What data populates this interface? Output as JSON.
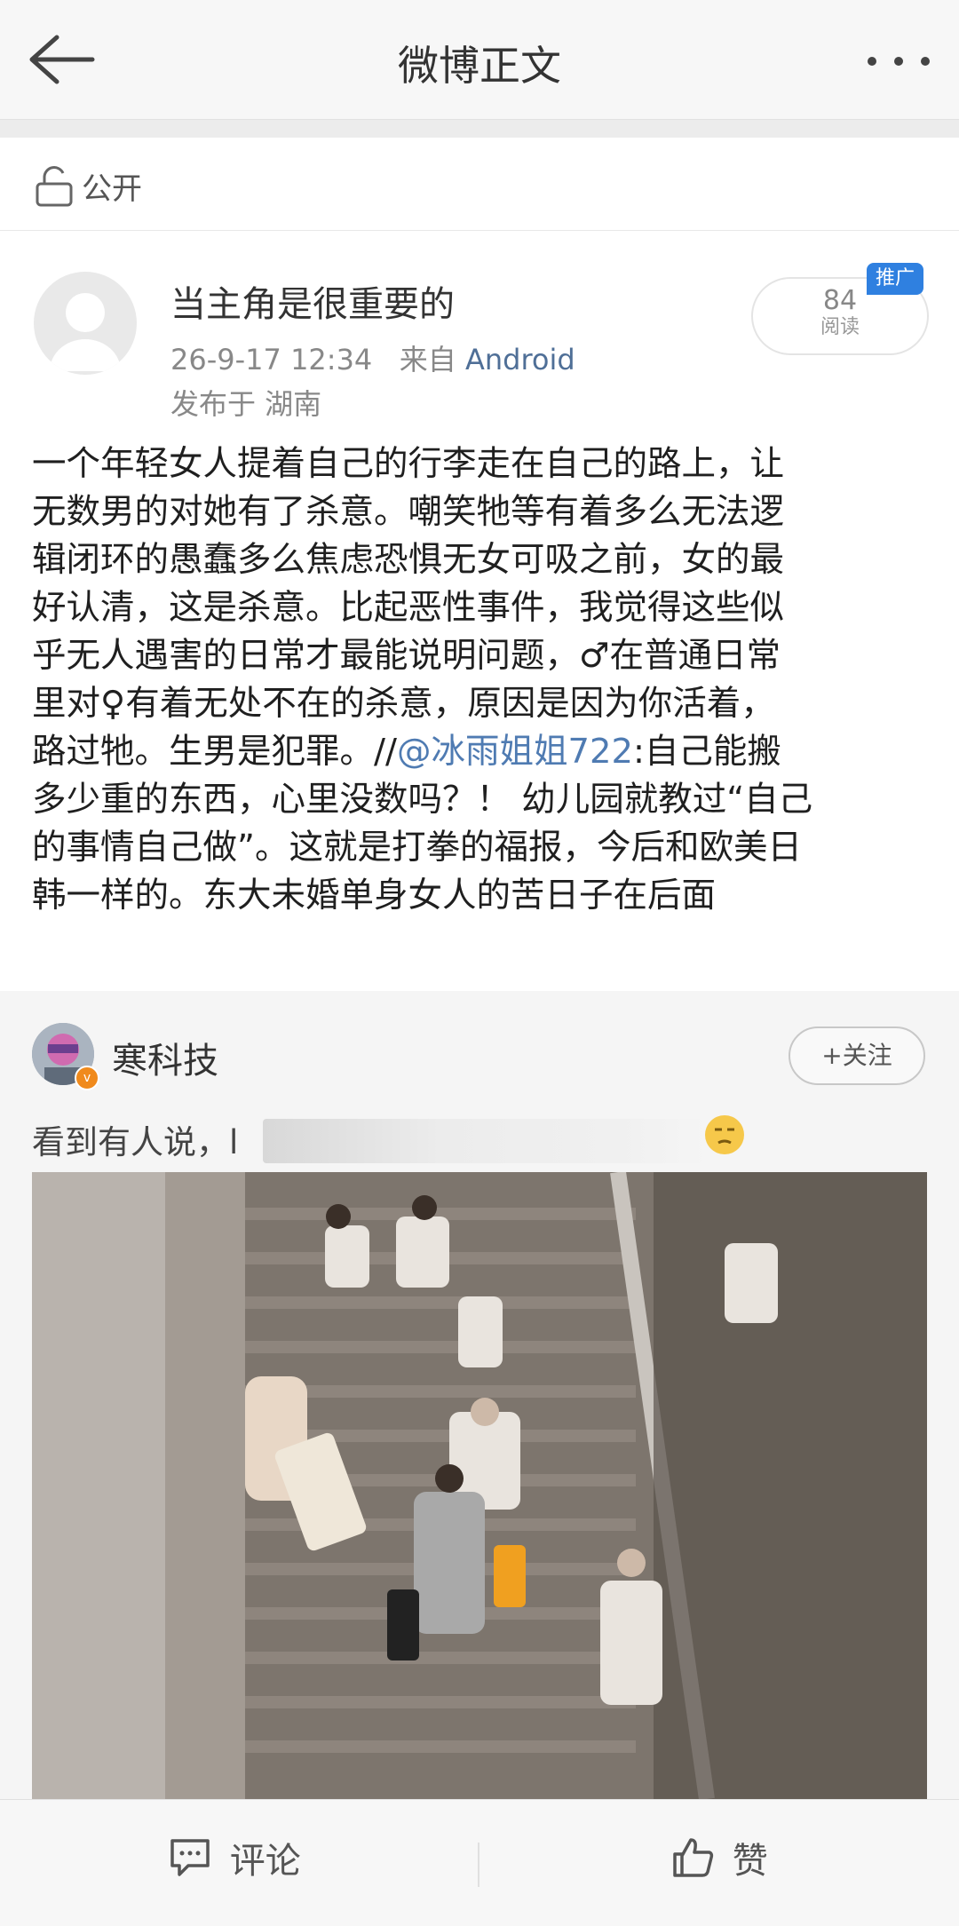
{
  "header": {
    "title": "微博正文",
    "back_icon": "back-arrow-icon",
    "more_icon": "more-dots-icon"
  },
  "visibility": {
    "label": "公开",
    "icon": "unlock-icon"
  },
  "post": {
    "author": "当主角是很重要的",
    "time": "26-9-17 12:34",
    "from_prefix": "来自",
    "source": "Android",
    "location": "发布于 湖南",
    "reads_count": "84",
    "reads_label": "阅读",
    "promo_badge": "推广",
    "body_lines": [
      "一个年轻女人提着自己的行李走在自己的路上，让",
      "无数男的对她有了杀意。嘲笑牠等有着多么无法逻",
      "辑闭环的愚蠢多么焦虑恐惧无女可吸之前，女的最",
      "好认清，这是杀意。比起恶性事件，我觉得这些似",
      "乎无人遇害的日常才最能说明问题，♂在普通日常",
      "里对♀有着无处不在的杀意，原因是因为你活着，"
    ],
    "line7_pre": "路过牠。生男是犯罪。//",
    "mention": "@冰雨姐姐722",
    "line7_post": ":自己能搬",
    "body_lines_end": [
      "多少重的东西，心里没数吗？！ 幼儿园就教过“自己",
      "的事情自己做”。这就是打拳的福报，今后和欧美日",
      "韩一样的。东大未婚单身女人的苦日子在后面"
    ]
  },
  "repost": {
    "author": "寒科技",
    "verified_badge": "v",
    "follow_label": "+关注",
    "text": "看到有人说，l",
    "emoji": "thinking-face-emoji",
    "image": "photo-stairs-crowd"
  },
  "bottom": {
    "comment_label": "评论",
    "like_label": "赞",
    "comment_icon": "comment-icon",
    "like_icon": "thumbs-up-icon"
  }
}
